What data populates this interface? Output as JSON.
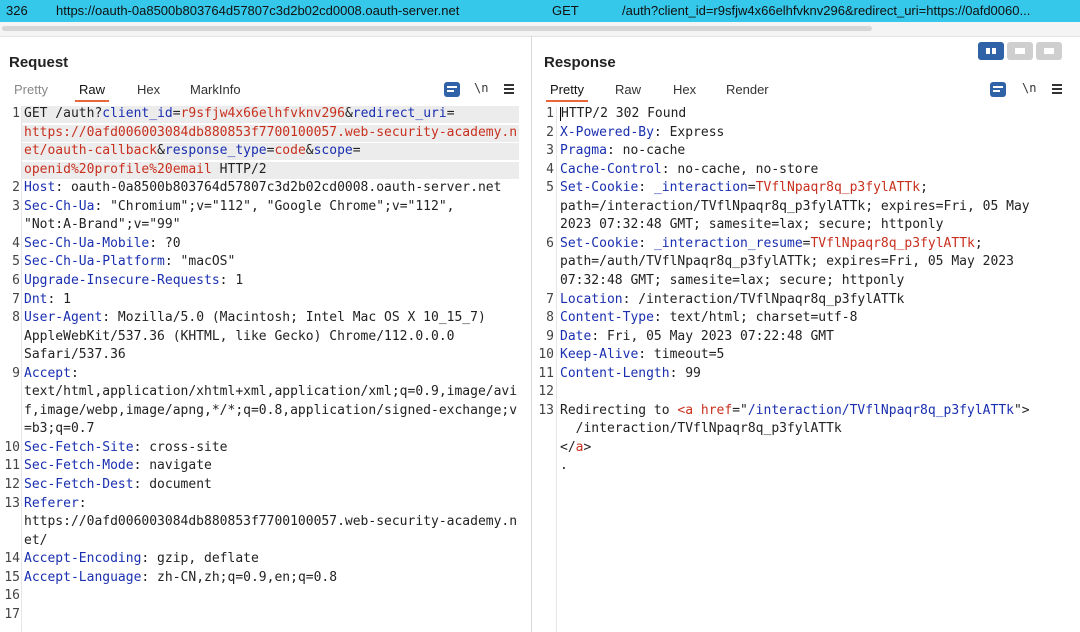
{
  "url_bar": {
    "index": "326",
    "host": "https://oauth-0a8500b803764d57807c3d2b02cd0008.oauth-server.net",
    "method": "GET",
    "path": "/auth?client_id=r9sfjw4x66elhfvknv296&redirect_uri=https://0afd0060..."
  },
  "request": {
    "title": "Request",
    "tabs": [
      "Pretty",
      "Raw",
      "Hex",
      "MarkInfo"
    ],
    "active_tab": "Raw",
    "newline_toggle": "\\n",
    "lines": [
      {
        "n": "1",
        "segs": [
          [
            "t",
            "GET /auth?"
          ],
          [
            "k",
            "client_id"
          ],
          [
            "t",
            "="
          ],
          [
            "v",
            "r9sfjw4x66elhfvknv296"
          ],
          [
            "t",
            "&"
          ],
          [
            "k",
            "redirect_uri"
          ],
          [
            "t",
            "="
          ]
        ]
      },
      {
        "n": "",
        "segs": [
          [
            "v",
            "https://0afd006003084db880853f7700100057.web-security-academy.n"
          ]
        ]
      },
      {
        "n": "",
        "segs": [
          [
            "v",
            "et/oauth-callback"
          ],
          [
            "t",
            "&"
          ],
          [
            "k",
            "response_type"
          ],
          [
            "t",
            "="
          ],
          [
            "v",
            "code"
          ],
          [
            "t",
            "&"
          ],
          [
            "k",
            "scope"
          ],
          [
            "t",
            "="
          ]
        ]
      },
      {
        "n": "",
        "segs": [
          [
            "v",
            "openid%20profile%20email"
          ],
          [
            "t",
            " HTTP/2"
          ]
        ]
      },
      {
        "n": "2",
        "segs": [
          [
            "k",
            "Host"
          ],
          [
            "t",
            ": oauth-0a8500b803764d57807c3d2b02cd0008.oauth-server.net"
          ]
        ]
      },
      {
        "n": "3",
        "segs": [
          [
            "k",
            "Sec-Ch-Ua"
          ],
          [
            "t",
            ": \"Chromium\";v=\"112\", \"Google Chrome\";v=\"112\","
          ]
        ]
      },
      {
        "n": "",
        "segs": [
          [
            "t",
            "\"Not:A-Brand\";v=\"99\""
          ]
        ]
      },
      {
        "n": "4",
        "segs": [
          [
            "k",
            "Sec-Ch-Ua-Mobile"
          ],
          [
            "t",
            ": ?0"
          ]
        ]
      },
      {
        "n": "5",
        "segs": [
          [
            "k",
            "Sec-Ch-Ua-Platform"
          ],
          [
            "t",
            ": \"macOS\""
          ]
        ]
      },
      {
        "n": "6",
        "segs": [
          [
            "k",
            "Upgrade-Insecure-Requests"
          ],
          [
            "t",
            ": 1"
          ]
        ]
      },
      {
        "n": "7",
        "segs": [
          [
            "k",
            "Dnt"
          ],
          [
            "t",
            ": 1"
          ]
        ]
      },
      {
        "n": "8",
        "segs": [
          [
            "k",
            "User-Agent"
          ],
          [
            "t",
            ": Mozilla/5.0 (Macintosh; Intel Mac OS X 10_15_7)"
          ]
        ]
      },
      {
        "n": "",
        "segs": [
          [
            "t",
            "AppleWebKit/537.36 (KHTML, like Gecko) Chrome/112.0.0.0"
          ]
        ]
      },
      {
        "n": "",
        "segs": [
          [
            "t",
            "Safari/537.36"
          ]
        ]
      },
      {
        "n": "9",
        "segs": [
          [
            "k",
            "Accept"
          ],
          [
            "t",
            ":"
          ]
        ]
      },
      {
        "n": "",
        "segs": [
          [
            "t",
            "text/html,application/xhtml+xml,application/xml;q=0.9,image/avi"
          ]
        ]
      },
      {
        "n": "",
        "segs": [
          [
            "t",
            "f,image/webp,image/apng,*/*;q=0.8,application/signed-exchange;v"
          ]
        ]
      },
      {
        "n": "",
        "segs": [
          [
            "t",
            "=b3;q=0.7"
          ]
        ]
      },
      {
        "n": "10",
        "segs": [
          [
            "k",
            "Sec-Fetch-Site"
          ],
          [
            "t",
            ": cross-site"
          ]
        ]
      },
      {
        "n": "11",
        "segs": [
          [
            "k",
            "Sec-Fetch-Mode"
          ],
          [
            "t",
            ": navigate"
          ]
        ]
      },
      {
        "n": "12",
        "segs": [
          [
            "k",
            "Sec-Fetch-Dest"
          ],
          [
            "t",
            ": document"
          ]
        ]
      },
      {
        "n": "13",
        "segs": [
          [
            "k",
            "Referer"
          ],
          [
            "t",
            ":"
          ]
        ]
      },
      {
        "n": "",
        "segs": [
          [
            "t",
            "https://0afd006003084db880853f7700100057.web-security-academy.n"
          ]
        ]
      },
      {
        "n": "",
        "segs": [
          [
            "t",
            "et/"
          ]
        ]
      },
      {
        "n": "14",
        "segs": [
          [
            "k",
            "Accept-Encoding"
          ],
          [
            "t",
            ": gzip, deflate"
          ]
        ]
      },
      {
        "n": "15",
        "segs": [
          [
            "k",
            "Accept-Language"
          ],
          [
            "t",
            ": zh-CN,zh;q=0.9,en;q=0.8"
          ]
        ]
      },
      {
        "n": "16",
        "segs": []
      },
      {
        "n": "17",
        "segs": []
      }
    ]
  },
  "response": {
    "title": "Response",
    "tabs": [
      "Pretty",
      "Raw",
      "Hex",
      "Render"
    ],
    "active_tab": "Pretty",
    "newline_toggle": "\\n",
    "lines": [
      {
        "n": "1",
        "segs": [
          [
            "c",
            ""
          ],
          [
            "t",
            "HTTP/2 302 Found"
          ]
        ]
      },
      {
        "n": "2",
        "segs": [
          [
            "k",
            "X-Powered-By"
          ],
          [
            "t",
            ": Express"
          ]
        ]
      },
      {
        "n": "3",
        "segs": [
          [
            "k",
            "Pragma"
          ],
          [
            "t",
            ": no-cache"
          ]
        ]
      },
      {
        "n": "4",
        "segs": [
          [
            "k",
            "Cache-Control"
          ],
          [
            "t",
            ": no-cache, no-store"
          ]
        ]
      },
      {
        "n": "5",
        "segs": [
          [
            "k",
            "Set-Cookie"
          ],
          [
            "t",
            ": "
          ],
          [
            "k",
            "_interaction"
          ],
          [
            "t",
            "="
          ],
          [
            "v",
            "TVflNpaqr8q_p3fylATTk"
          ],
          [
            "t",
            ";"
          ]
        ]
      },
      {
        "n": "",
        "segs": [
          [
            "t",
            "path=/interaction/TVflNpaqr8q_p3fylATTk; expires=Fri, 05 May"
          ]
        ]
      },
      {
        "n": "",
        "segs": [
          [
            "t",
            "2023 07:32:48 GMT; samesite=lax; secure; httponly"
          ]
        ]
      },
      {
        "n": "6",
        "segs": [
          [
            "k",
            "Set-Cookie"
          ],
          [
            "t",
            ": "
          ],
          [
            "k",
            "_interaction_resume"
          ],
          [
            "t",
            "="
          ],
          [
            "v",
            "TVflNpaqr8q_p3fylATTk"
          ],
          [
            "t",
            ";"
          ]
        ]
      },
      {
        "n": "",
        "segs": [
          [
            "t",
            "path=/auth/TVflNpaqr8q_p3fylATTk; expires=Fri, 05 May 2023"
          ]
        ]
      },
      {
        "n": "",
        "segs": [
          [
            "t",
            "07:32:48 GMT; samesite=lax; secure; httponly"
          ]
        ]
      },
      {
        "n": "7",
        "segs": [
          [
            "k",
            "Location"
          ],
          [
            "t",
            ": /interaction/TVflNpaqr8q_p3fylATTk"
          ]
        ]
      },
      {
        "n": "8",
        "segs": [
          [
            "k",
            "Content-Type"
          ],
          [
            "t",
            ": text/html; charset=utf-8"
          ]
        ]
      },
      {
        "n": "9",
        "segs": [
          [
            "k",
            "Date"
          ],
          [
            "t",
            ": Fri, 05 May 2023 07:22:48 GMT"
          ]
        ]
      },
      {
        "n": "10",
        "segs": [
          [
            "k",
            "Keep-Alive"
          ],
          [
            "t",
            ": timeout=5"
          ]
        ]
      },
      {
        "n": "11",
        "segs": [
          [
            "k",
            "Content-Length"
          ],
          [
            "t",
            ": 99"
          ]
        ]
      },
      {
        "n": "12",
        "segs": []
      },
      {
        "n": "13",
        "segs": [
          [
            "t",
            "Redirecting to "
          ],
          [
            "v",
            "<a"
          ],
          [
            "t",
            " "
          ],
          [
            "v",
            "href"
          ],
          [
            "t",
            "=\""
          ],
          [
            "k",
            "/interaction/TVflNpaqr8q_p3fylATTk"
          ],
          [
            "t",
            "\">"
          ]
        ]
      },
      {
        "n": "",
        "segs": [
          [
            "t",
            "  /interaction/TVflNpaqr8q_p3fylATTk"
          ]
        ]
      },
      {
        "n": "",
        "segs": [
          [
            "t",
            "</"
          ],
          [
            "v",
            "a"
          ],
          [
            "t",
            ">"
          ]
        ]
      },
      {
        "n": "",
        "segs": [
          [
            "t",
            "."
          ]
        ]
      }
    ]
  }
}
